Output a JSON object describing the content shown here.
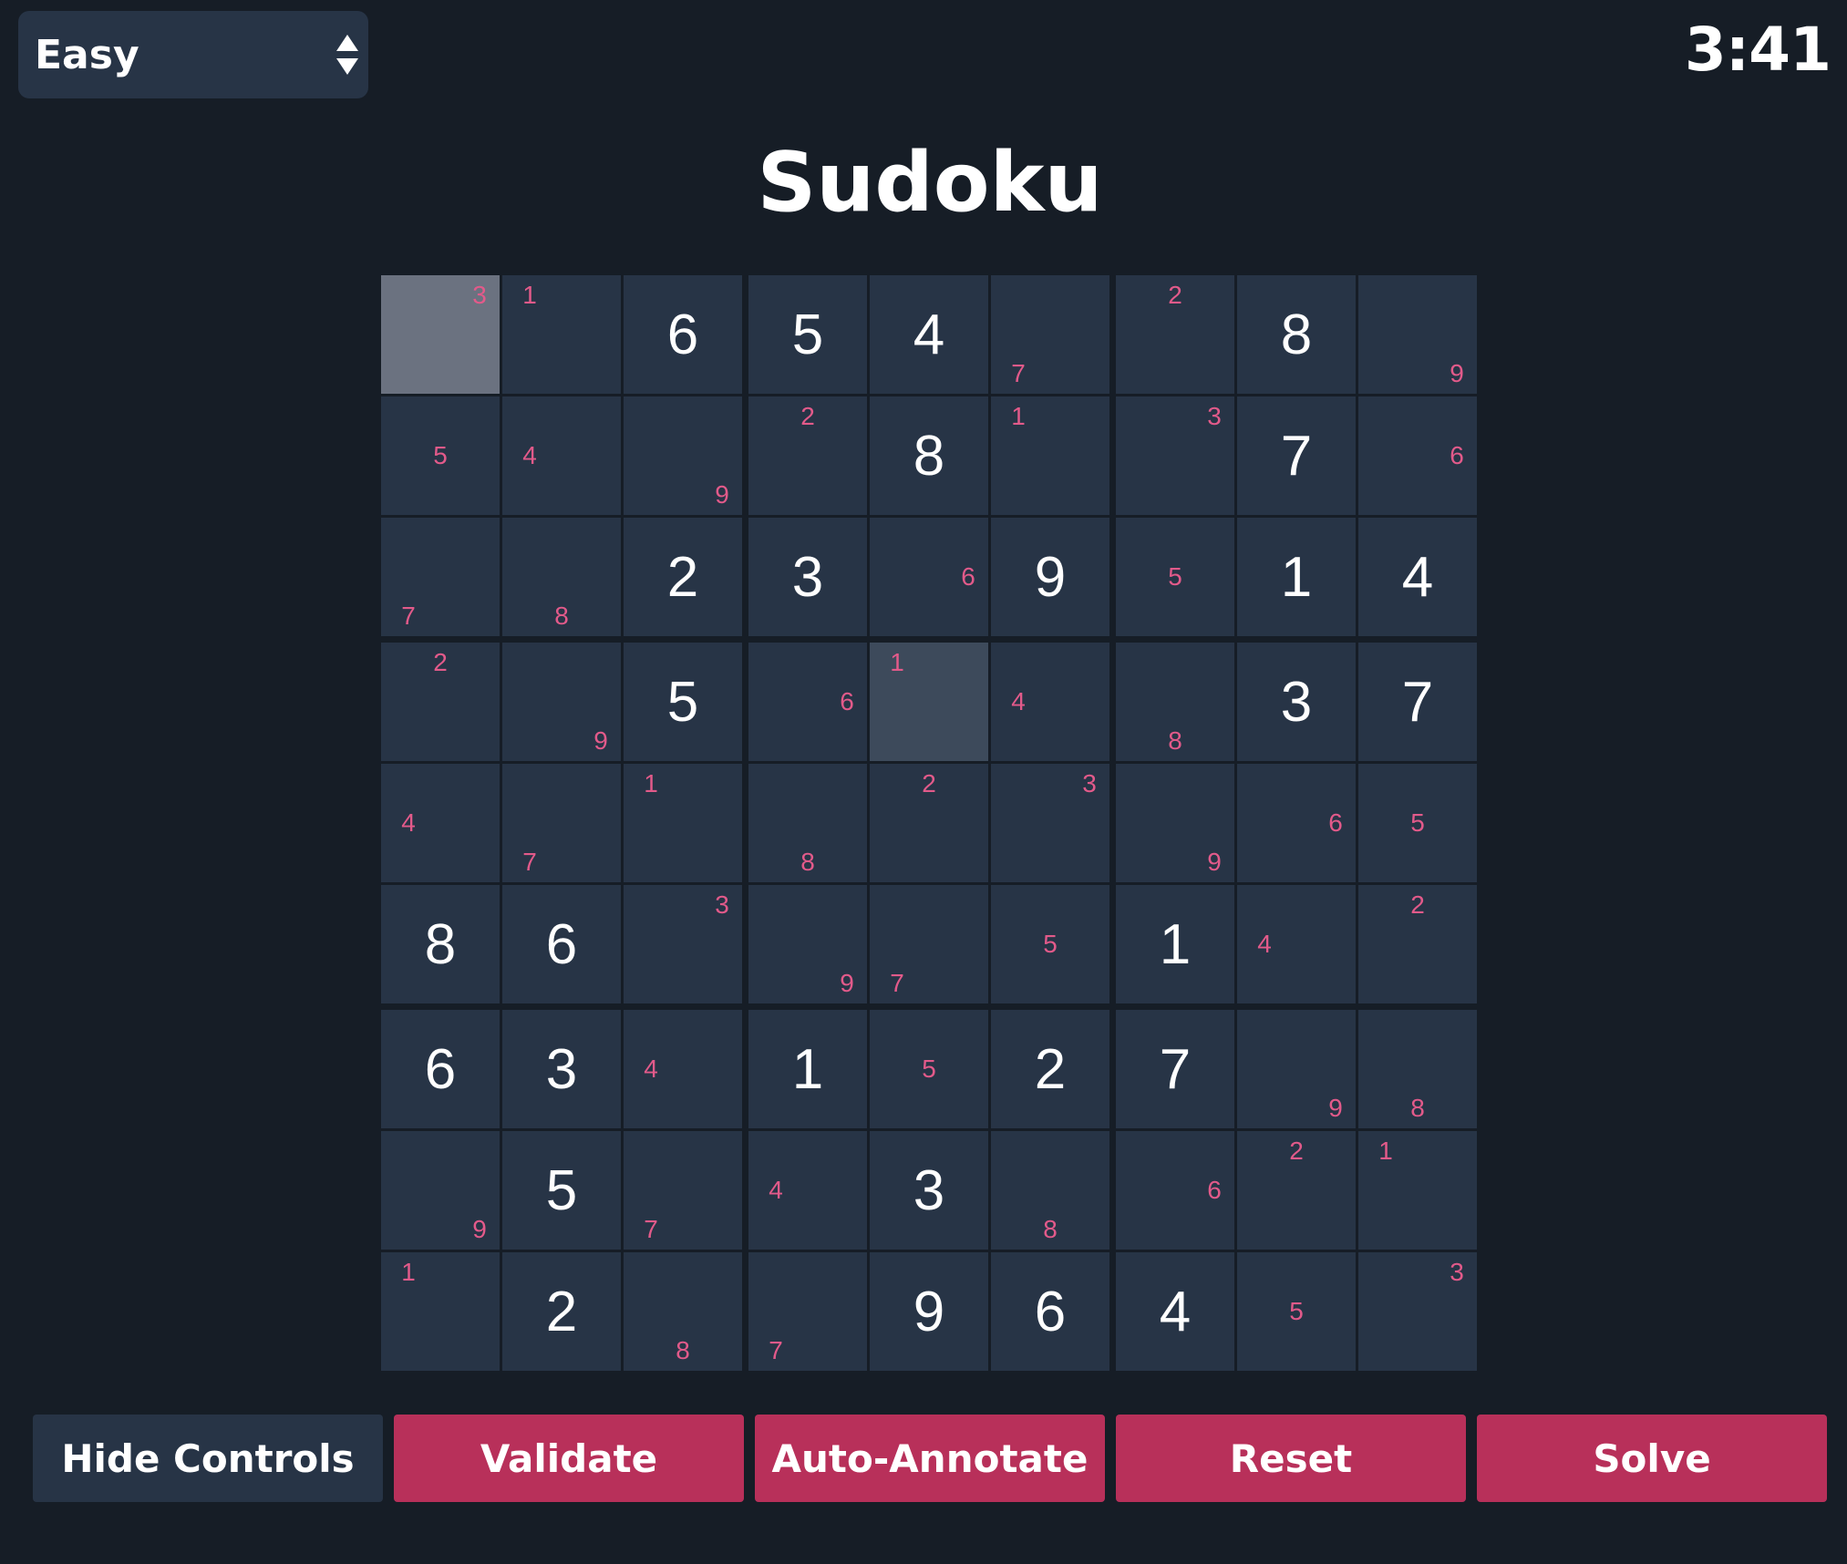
{
  "difficulty": {
    "selected": "Easy",
    "arrows_icon": "up-down-arrows-icon"
  },
  "timer": "3:41",
  "title": "Sudoku",
  "colors": {
    "background": "#161d26",
    "cell": "#273446",
    "selected_cell": "#6b7280",
    "highlight_cell": "#3d4a5b",
    "note": "#e25a8a",
    "accent_button": "#b8305a"
  },
  "board": {
    "selected": [
      0,
      0
    ],
    "highlighted": [
      [
        3,
        4
      ]
    ],
    "values": [
      [
        "",
        "",
        "6",
        "5",
        "4",
        "",
        "",
        "8",
        ""
      ],
      [
        "",
        "",
        "",
        "",
        "8",
        "",
        "",
        "7",
        ""
      ],
      [
        "",
        "",
        "2",
        "3",
        "",
        "9",
        "",
        "1",
        "4"
      ],
      [
        "",
        "",
        "5",
        "",
        "",
        "",
        "",
        "3",
        "7"
      ],
      [
        "",
        "",
        "",
        "",
        "",
        "",
        "",
        "",
        ""
      ],
      [
        "8",
        "6",
        "",
        "",
        "",
        "",
        "1",
        "",
        ""
      ],
      [
        "6",
        "3",
        "",
        "1",
        "",
        "2",
        "7",
        "",
        ""
      ],
      [
        "",
        "5",
        "",
        "",
        "3",
        "",
        "",
        "",
        ""
      ],
      [
        "",
        "2",
        "",
        "",
        "9",
        "6",
        "4",
        "",
        ""
      ]
    ],
    "notes": [
      [
        [
          3
        ],
        [
          1
        ],
        [],
        [],
        [],
        [
          7
        ],
        [
          2
        ],
        [],
        [
          9
        ]
      ],
      [
        [
          5
        ],
        [
          4
        ],
        [
          9
        ],
        [
          2
        ],
        [],
        [
          1
        ],
        [
          3
        ],
        [],
        [
          6
        ]
      ],
      [
        [
          7
        ],
        [
          8
        ],
        [],
        [],
        [
          6
        ],
        [],
        [
          5
        ],
        [],
        []
      ],
      [
        [
          2
        ],
        [
          9
        ],
        [],
        [
          6
        ],
        [
          1
        ],
        [
          4
        ],
        [
          8
        ],
        [],
        []
      ],
      [
        [
          4
        ],
        [
          7
        ],
        [
          1
        ],
        [
          8
        ],
        [
          2
        ],
        [
          3
        ],
        [
          9
        ],
        [
          6
        ],
        [
          5
        ]
      ],
      [
        [],
        [],
        [
          3
        ],
        [
          9
        ],
        [
          7
        ],
        [
          5
        ],
        [],
        [
          4
        ],
        [
          2
        ]
      ],
      [
        [],
        [],
        [
          4
        ],
        [],
        [
          5
        ],
        [],
        [],
        [
          9
        ],
        [
          8
        ]
      ],
      [
        [
          9
        ],
        [],
        [
          7
        ],
        [
          4
        ],
        [],
        [
          8
        ],
        [
          6
        ],
        [
          2
        ],
        [
          1
        ]
      ],
      [
        [
          1
        ],
        [],
        [
          8
        ],
        [
          7
        ],
        [],
        [],
        [],
        [
          5
        ],
        [
          3
        ]
      ]
    ]
  },
  "buttons": {
    "hide_controls": "Hide Controls",
    "validate": "Validate",
    "auto_annotate": "Auto-Annotate",
    "reset": "Reset",
    "solve": "Solve"
  }
}
